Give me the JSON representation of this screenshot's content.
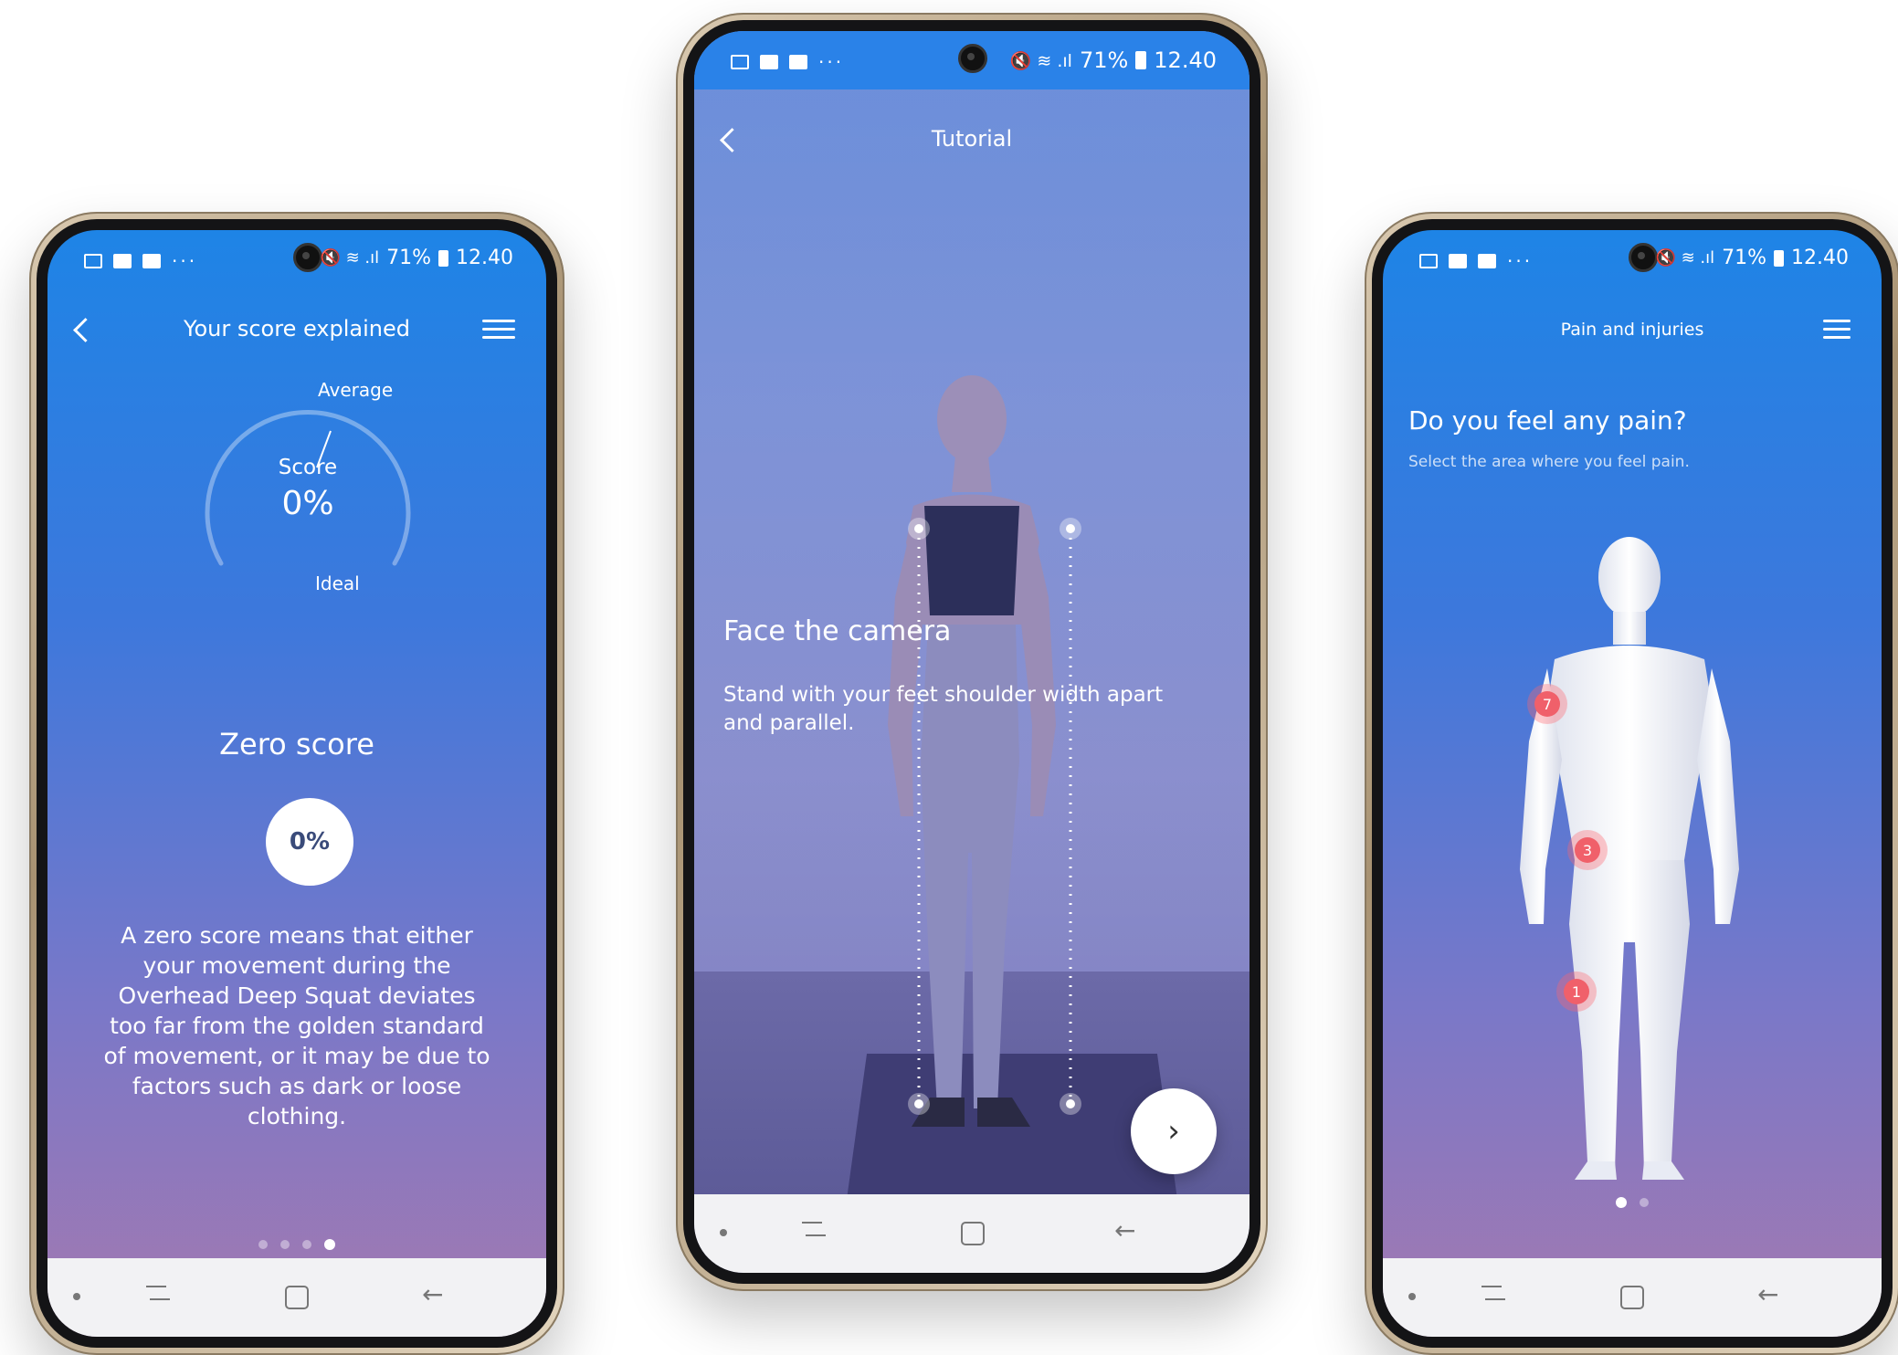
{
  "status": {
    "battery": "71%",
    "time": "12.40",
    "dots": "···",
    "signal": "🔇 ≋ .ıl"
  },
  "phone1": {
    "title": "Your score explained",
    "gauge": {
      "label": "Score",
      "value": "0%",
      "top_label": "Average",
      "bottom_label": "Ideal"
    },
    "heading": "Zero score",
    "badge": "0%",
    "body": "A zero score means that either your movement during the Overhead Deep Squat deviates too far from the golden standard of movement, or it may be due to factors such as dark or loose clothing.",
    "page_count": 4,
    "active_page": 4
  },
  "phone2": {
    "title": "Tutorial",
    "heading": "Face the camera",
    "body": "Stand with your feet shoulder width apart and parallel.",
    "next_glyph": "›"
  },
  "phone3": {
    "title": "Pain and injuries",
    "question": "Do you feel any pain?",
    "hint": "Select the area where you feel pain.",
    "markers": [
      "7",
      "3",
      "1"
    ],
    "page_count": 2,
    "active_page": 1
  },
  "nav": {
    "back_glyph": "←"
  }
}
